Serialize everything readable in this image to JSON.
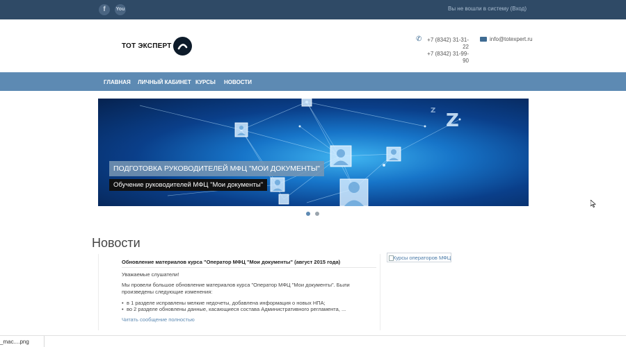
{
  "topbar": {
    "social": [
      {
        "name": "facebook-icon",
        "glyph": "f"
      },
      {
        "name": "youtube-icon",
        "glyph": "You"
      }
    ],
    "login_text": "Вы не вошли в систему (",
    "login_link": "Вход",
    "login_close": ")"
  },
  "header": {
    "logo_text": "ТОТ ЭКСПЕРТ",
    "phone_1": "+7 (8342) 31-31-22",
    "phone_2": "+7 (8342) 31-99-90",
    "email": "info@totexpert.ru"
  },
  "nav": {
    "items": [
      "ГЛАВНАЯ",
      "ЛИЧНЫЙ КАБИНЕТ",
      "КУРСЫ",
      "НОВОСТИ"
    ]
  },
  "slider": {
    "title": "ПОДГОТОВКА РУКОВОДИТЕЛЕЙ МФЦ \"МОИ ДОКУМЕНТЫ\"",
    "subtitle": "Обучение руководителей МФЦ \"Мои документы\"",
    "active_slide": 1,
    "slide_count": 2
  },
  "news": {
    "heading": "Новости",
    "item": {
      "title": "Обновление материалов курса \"Оператор МФЦ \"Мои документы\" (август 2015 года)",
      "greeting": "Уважаемые слушатели!",
      "body": "Мы провели большое обновление материалов курса \"Оператор МФЦ \"Мои документы\". Были произведены следующие изменения:",
      "list": [
        "в 1 разделе исправлены мелкие недочеты, добавлена информация о новых НПА;",
        "во 2 разделе обновлены данные, касающиеся состава Административного регламента, ..."
      ],
      "read_more": "Читать сообщение полностью"
    },
    "side_image_alt": "Курсы операторов МФЦ"
  },
  "download_bar": {
    "file_name": "_mac....png"
  }
}
